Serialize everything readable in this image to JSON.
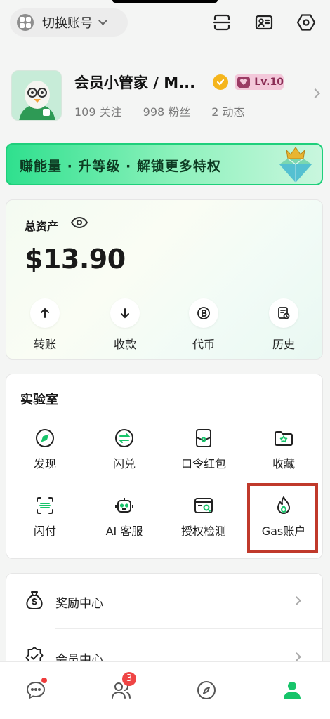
{
  "header": {
    "switch_account_label": "切换账号",
    "icons": [
      "grid-icon",
      "chevron-down-icon",
      "scan-icon",
      "id-card-icon",
      "settings-icon"
    ]
  },
  "profile": {
    "name": "会员小管家 / M...",
    "level": "Lv.10",
    "following": "109 关注",
    "followers": "998 粉丝",
    "posts": "2 动态"
  },
  "banner": {
    "text": "赚能量 · 升等级 · 解锁更多特权"
  },
  "assets": {
    "title": "总资产",
    "amount": "$13.90",
    "actions": [
      {
        "label": "转账",
        "icon": "arrow-up-icon"
      },
      {
        "label": "收款",
        "icon": "arrow-down-icon"
      },
      {
        "label": "代币",
        "icon": "bitcoin-icon"
      },
      {
        "label": "历史",
        "icon": "history-icon"
      }
    ]
  },
  "lab": {
    "title": "实验室",
    "items": [
      {
        "label": "发现",
        "icon": "compass-icon"
      },
      {
        "label": "闪兑",
        "icon": "swap-icon"
      },
      {
        "label": "口令红包",
        "icon": "red-packet-icon"
      },
      {
        "label": "收藏",
        "icon": "folder-star-icon"
      },
      {
        "label": "闪付",
        "icon": "scan-pay-icon"
      },
      {
        "label": "AI 客服",
        "icon": "robot-icon"
      },
      {
        "label": "授权检测",
        "icon": "auth-check-icon"
      },
      {
        "label": "Gas账户",
        "icon": "flame-icon"
      }
    ]
  },
  "menu": {
    "items": [
      {
        "label": "奖励中心",
        "icon": "money-bag-icon"
      },
      {
        "label": "会员中心",
        "icon": "badge-check-icon"
      }
    ]
  },
  "bottom_nav": {
    "badge_count": "3",
    "items": [
      "chat-icon",
      "contacts-icon",
      "discover-icon",
      "profile-icon"
    ]
  },
  "colors": {
    "accent": "#17c46a",
    "highlight_box": "#c0392b",
    "badge": "#ef4545"
  }
}
